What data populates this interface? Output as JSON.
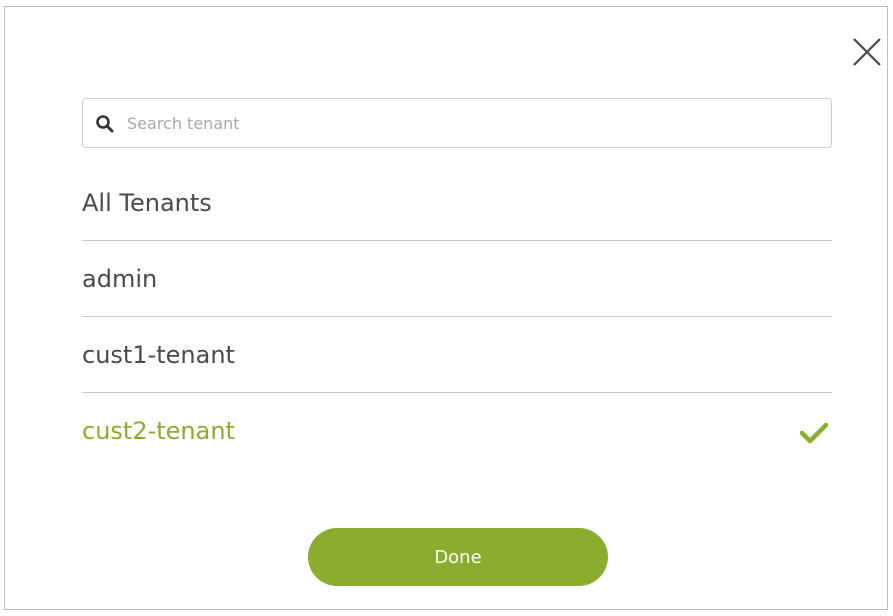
{
  "search": {
    "placeholder": "Search tenant",
    "value": ""
  },
  "tenants": [
    {
      "label": "All Tenants",
      "selected": false
    },
    {
      "label": "admin",
      "selected": false
    },
    {
      "label": "cust1-tenant",
      "selected": false
    },
    {
      "label": "cust2-tenant",
      "selected": true
    }
  ],
  "done_label": "Done",
  "icons": {
    "close": "close-icon",
    "search": "search-icon",
    "selected": "checkmark-icon"
  },
  "colors": {
    "accent": "#8aad2e",
    "text": "#4a4a4a",
    "divider": "#c8c8c8",
    "placeholder": "#a8a8a8"
  }
}
